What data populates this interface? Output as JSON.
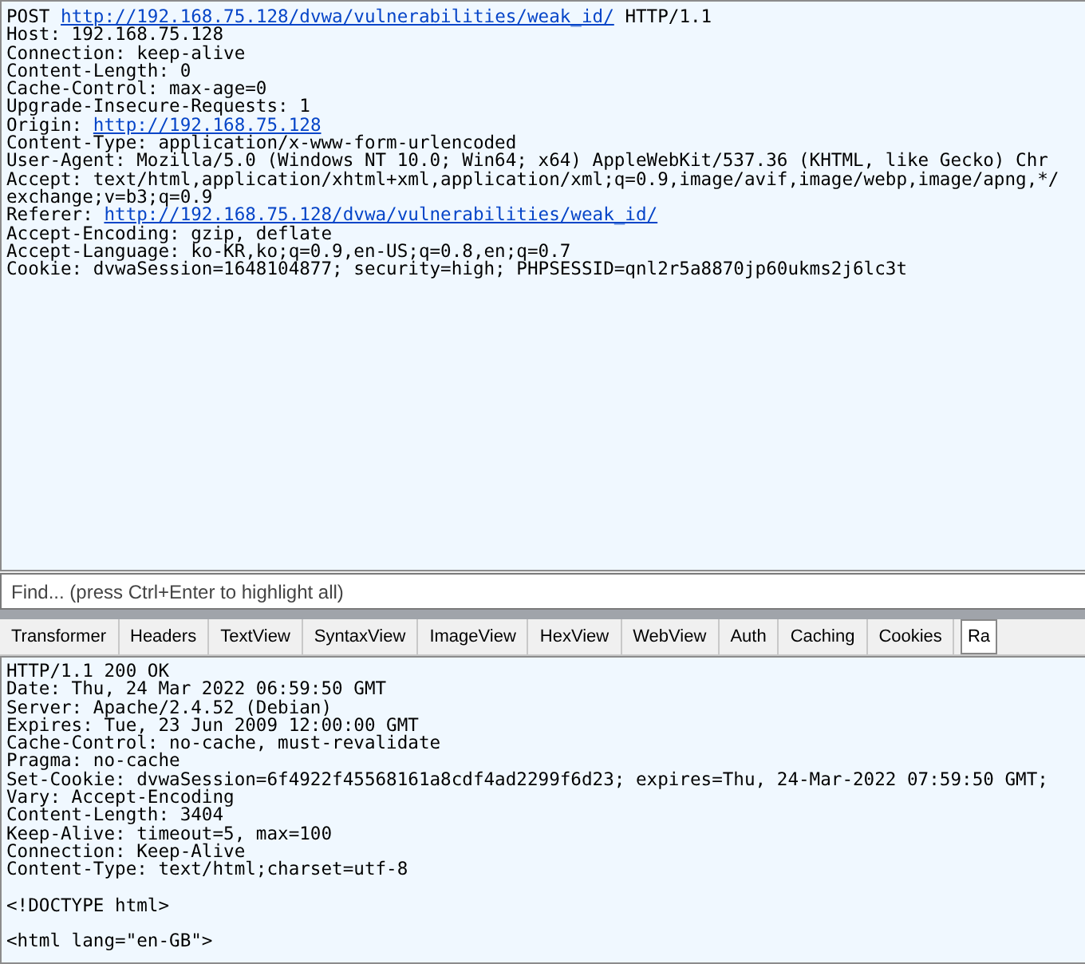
{
  "request": {
    "lines": [
      [
        {
          "kind": "plain",
          "text": "POST "
        },
        {
          "kind": "link",
          "text": "http://192.168.75.128/dvwa/vulnerabilities/weak_id/"
        },
        {
          "kind": "plain",
          "text": " HTTP/1.1"
        }
      ],
      [
        {
          "kind": "plain",
          "text": "Host: 192.168.75.128"
        }
      ],
      [
        {
          "kind": "plain",
          "text": "Connection: keep-alive"
        }
      ],
      [
        {
          "kind": "plain",
          "text": "Content-Length: 0"
        }
      ],
      [
        {
          "kind": "plain",
          "text": "Cache-Control: max-age=0"
        }
      ],
      [
        {
          "kind": "plain",
          "text": "Upgrade-Insecure-Requests: 1"
        }
      ],
      [
        {
          "kind": "plain",
          "text": "Origin: "
        },
        {
          "kind": "link",
          "text": "http://192.168.75.128"
        }
      ],
      [
        {
          "kind": "plain",
          "text": "Content-Type: application/x-www-form-urlencoded"
        }
      ],
      [
        {
          "kind": "plain",
          "text": "User-Agent: Mozilla/5.0 (Windows NT 10.0; Win64; x64) AppleWebKit/537.36 (KHTML, like Gecko) Chr"
        }
      ],
      [
        {
          "kind": "plain",
          "text": "Accept: text/html,application/xhtml+xml,application/xml;q=0.9,image/avif,image/webp,image/apng,*/"
        }
      ],
      [
        {
          "kind": "plain",
          "text": "exchange;v=b3;q=0.9"
        }
      ],
      [
        {
          "kind": "plain",
          "text": "Referer: "
        },
        {
          "kind": "link",
          "text": "http://192.168.75.128/dvwa/vulnerabilities/weak_id/"
        }
      ],
      [
        {
          "kind": "plain",
          "text": "Accept-Encoding: gzip, deflate"
        }
      ],
      [
        {
          "kind": "plain",
          "text": "Accept-Language: ko-KR,ko;q=0.9,en-US;q=0.8,en;q=0.7"
        }
      ],
      [
        {
          "kind": "plain",
          "text": "Cookie: dvwaSession=1648104877; security=high; PHPSESSID=qnl2r5a8870jp60ukms2j6lc3t"
        }
      ]
    ]
  },
  "find": {
    "placeholder": "Find... (press Ctrl+Enter to highlight all)"
  },
  "tabs": [
    {
      "label": "Transformer",
      "selected": false
    },
    {
      "label": "Headers",
      "selected": false
    },
    {
      "label": "TextView",
      "selected": false
    },
    {
      "label": "SyntaxView",
      "selected": false
    },
    {
      "label": "ImageView",
      "selected": false
    },
    {
      "label": "HexView",
      "selected": false
    },
    {
      "label": "WebView",
      "selected": false
    },
    {
      "label": "Auth",
      "selected": false
    },
    {
      "label": "Caching",
      "selected": false
    },
    {
      "label": "Cookies",
      "selected": false
    },
    {
      "label": "Ra",
      "selected": true
    }
  ],
  "response": {
    "lines": [
      "HTTP/1.1 200 OK",
      "Date: Thu, 24 Mar 2022 06:59:50 GMT",
      "Server: Apache/2.4.52 (Debian)",
      "Expires: Tue, 23 Jun 2009 12:00:00 GMT",
      "Cache-Control: no-cache, must-revalidate",
      "Pragma: no-cache",
      "Set-Cookie: dvwaSession=6f4922f45568161a8cdf4ad2299f6d23; expires=Thu, 24-Mar-2022 07:59:50 GMT;",
      "Vary: Accept-Encoding",
      "Content-Length: 3404",
      "Keep-Alive: timeout=5, max=100",
      "Connection: Keep-Alive",
      "Content-Type: text/html;charset=utf-8",
      {
        "text": "<!DOCTYPE html>",
        "blank_before": true
      },
      {
        "text": "<html lang=\"en-GB\">",
        "blank_before": true
      }
    ]
  }
}
